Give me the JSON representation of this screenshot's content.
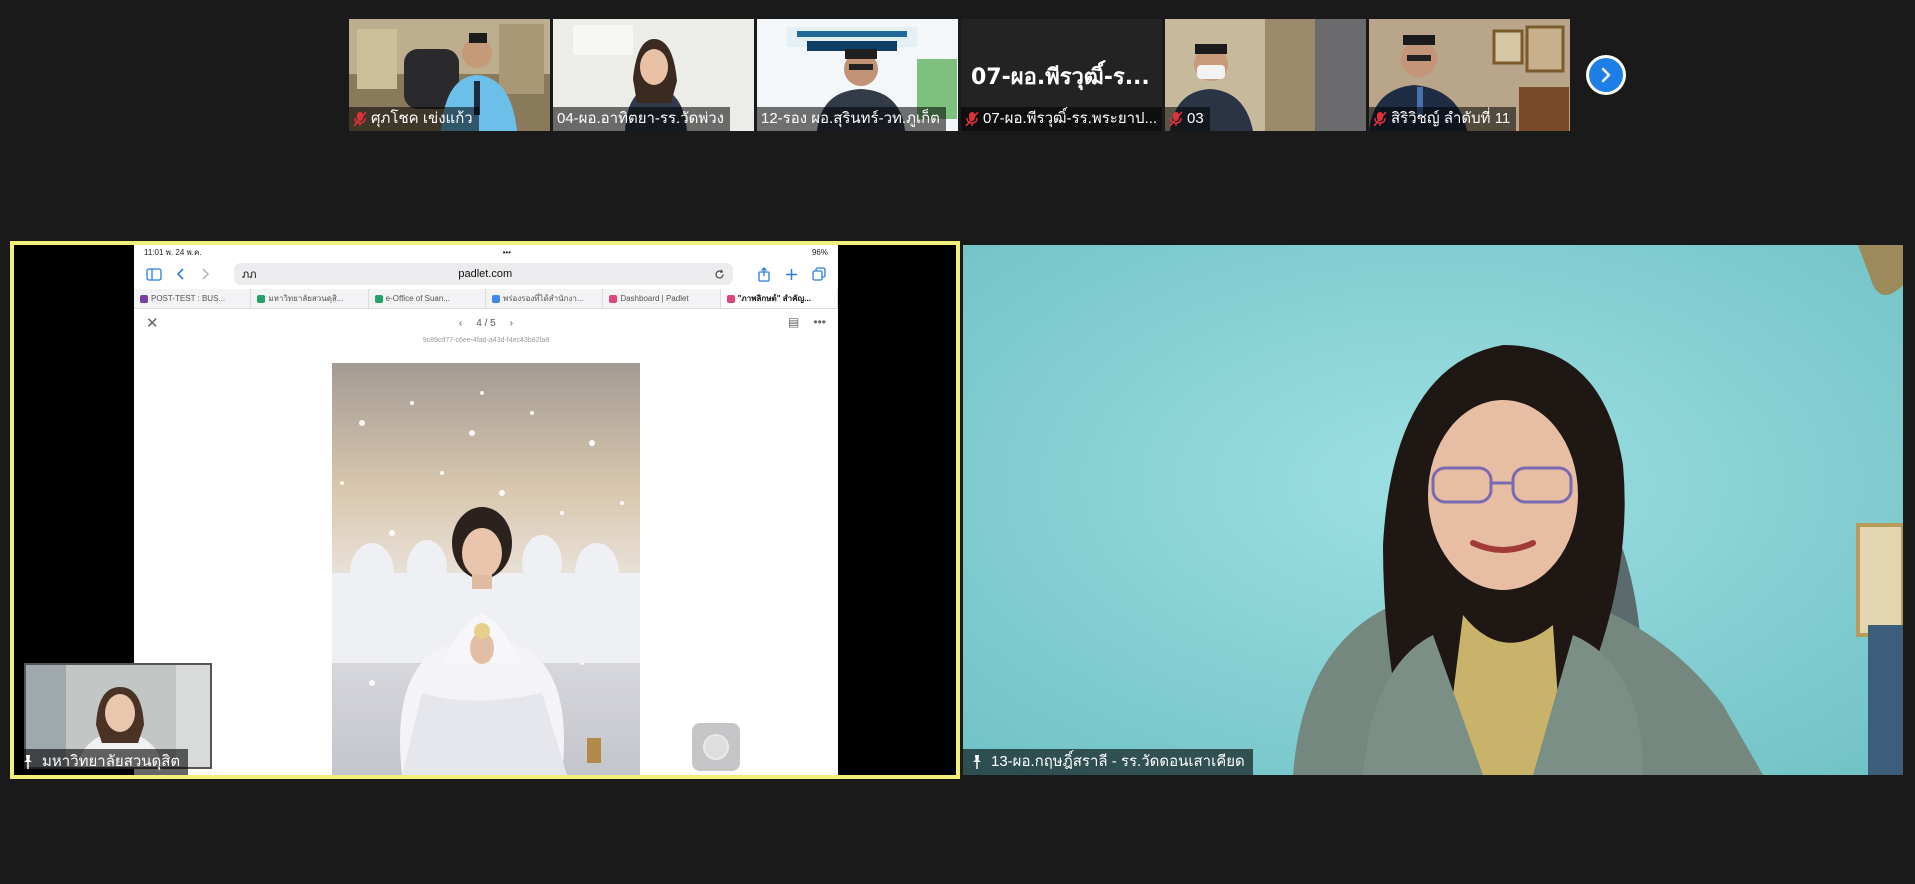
{
  "participants_strip": [
    {
      "name": "ศุภโชค  เข่งแก้ว",
      "muted": true,
      "scene": "man-blue-shirt"
    },
    {
      "name": "04-ผอ.อาทิตยา-รร.วัดพ่วง",
      "muted": false,
      "scene": "woman-whiteboard"
    },
    {
      "name": "12-รอง ผอ.สุรินทร์-วท.ภูเก็ต",
      "muted": false,
      "scene": "man-poster"
    },
    {
      "name": "07-ผอ.พีรวุฒิ์-รร.พระยาป...",
      "big_name": "07-ผอ.พีรวุฒิ์-ร...",
      "muted": true,
      "scene": "text-only"
    },
    {
      "name": "03",
      "muted": true,
      "scene": "man-mask"
    },
    {
      "name": "สิริวิชญ์  ลำดับที่ 11",
      "muted": true,
      "scene": "man-suit"
    }
  ],
  "next_button_icon": "chevron-right-icon",
  "main_left": {
    "name": "มหาวิทยาลัยสวนดุสิต",
    "pinned": true,
    "highlight_color": "#f2f07a",
    "shared_screen": {
      "status_time": "11:01",
      "status_date": "พ. 24 พ.ค.",
      "status_battery": "96%",
      "url_left": "ภภ",
      "url_domain": "padlet.com",
      "browser_tabs": [
        {
          "label": "POST-TEST : BUS...",
          "color": "#7b3fa0"
        },
        {
          "label": "มหาวิทยาลัยสวนดุสิ...",
          "color": "#26a269"
        },
        {
          "label": "e-Office of Suan...",
          "color": "#26a269"
        },
        {
          "label": "พร่องรองที่ได้สำนักงา...",
          "color": "#4285f4"
        },
        {
          "label": "Dashboard | Padlet",
          "color": "#e0457b"
        },
        {
          "label": "\"ภาพลิกษต์\" สำคัญ...",
          "color": "#e0457b"
        }
      ],
      "pager": "4 / 5",
      "post_id": "9c89cd77-c6ee-4fad-a43d-f4ec43b82fa8"
    }
  },
  "main_right": {
    "name": "13-ผอ.กฤษฎิ์สราลี - รร.วัดดอนเสาเคียด",
    "pinned": true
  },
  "colors": {
    "background": "#1a1a1a",
    "accent_blue": "#1d7fe6",
    "mic_off_red": "#e0313b"
  }
}
